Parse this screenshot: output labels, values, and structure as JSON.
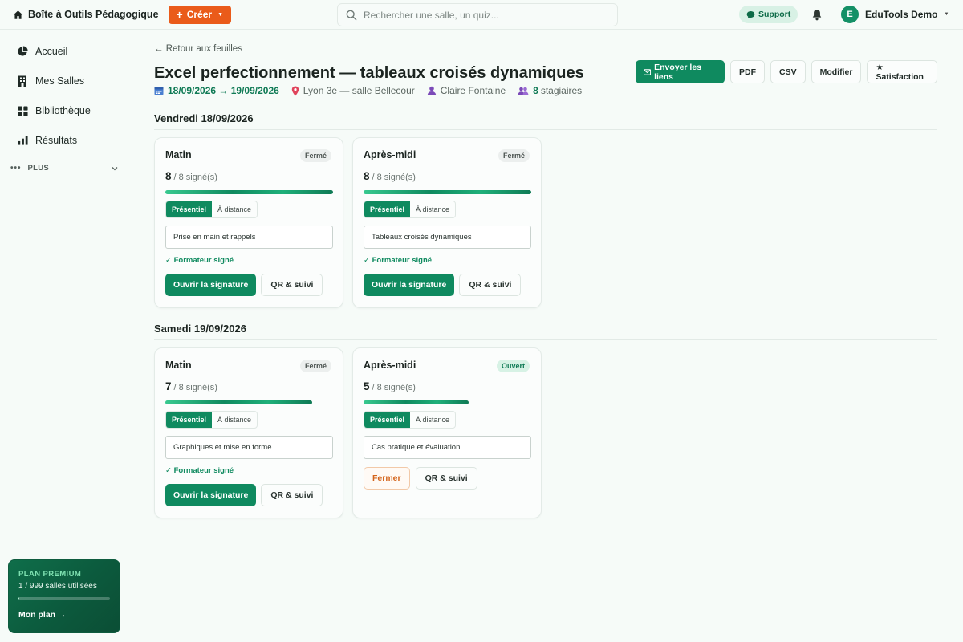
{
  "app": {
    "brand": "Boîte à Outils Pédagogique",
    "create_label": "Créer",
    "search_placeholder": "Rechercher une salle, un quiz...",
    "support_label": "Support",
    "user_initial": "E",
    "user_name": "EduTools Demo"
  },
  "sidebar": {
    "items": [
      {
        "label": "Accueil",
        "icon": "pie-chart-icon"
      },
      {
        "label": "Mes Salles",
        "icon": "building-icon"
      },
      {
        "label": "Bibliothèque",
        "icon": "grid-icon"
      },
      {
        "label": "Résultats",
        "icon": "bar-chart-icon"
      }
    ],
    "more_label": "PLUS",
    "premium": {
      "title": "PLAN PREMIUM",
      "usage": "1 / 999 salles utilisées",
      "usage_fraction": 0.001,
      "link": "Mon plan →"
    }
  },
  "header": {
    "back_label": "← Retour aux feuilles",
    "title": "Excel perfectionnement — tableaux croisés dynamiques",
    "dates": "18/09/2026 → 19/09/2026",
    "location": "Lyon 3e — salle Bellecour",
    "trainer": "Claire Fontaine",
    "trainee_count": "8",
    "trainee_label": "stagiaires",
    "actions": {
      "send": "Envoyer les liens",
      "pdf": "PDF",
      "csv": "CSV",
      "edit": "Modifier",
      "satisfaction": "★ Satisfaction"
    }
  },
  "days": [
    {
      "title": "Vendredi 18/09/2026",
      "sessions": [
        {
          "title": "Matin",
          "status": "Fermé",
          "signed": "8",
          "total": "/ 8 signé(s)",
          "progress": 1.0,
          "mode_on": "Présentiel",
          "mode_off": "À distance",
          "topic": "Prise en main et rappels",
          "trainer_signed": "✓ Formateur signé",
          "sign_label": "Ouvrir la signature",
          "qr_label": "QR & suivi"
        },
        {
          "title": "Après-midi",
          "status": "Fermé",
          "signed": "8",
          "total": "/ 8 signé(s)",
          "progress": 1.0,
          "mode_on": "Présentiel",
          "mode_off": "À distance",
          "topic": "Tableaux croisés dynamiques",
          "trainer_signed": "✓ Formateur signé",
          "sign_label": "Ouvrir la signature",
          "qr_label": "QR & suivi"
        }
      ]
    },
    {
      "title": "Samedi 19/09/2026",
      "sessions": [
        {
          "title": "Matin",
          "status": "Fermé",
          "signed": "7",
          "total": "/ 8 signé(s)",
          "progress": 0.875,
          "mode_on": "Présentiel",
          "mode_off": "À distance",
          "topic": "Graphiques et mise en forme",
          "trainer_signed": "✓ Formateur signé",
          "sign_label": "Ouvrir la signature",
          "qr_label": "QR & suivi"
        },
        {
          "title": "Après-midi",
          "status": "Ouvert",
          "signed": "5",
          "total": "/ 8 signé(s)",
          "progress": 0.625,
          "mode_on": "Présentiel",
          "mode_off": "À distance",
          "topic": "Cas pratique et évaluation",
          "close_label": "Fermer",
          "qr_label": "QR & suivi"
        }
      ]
    }
  ]
}
